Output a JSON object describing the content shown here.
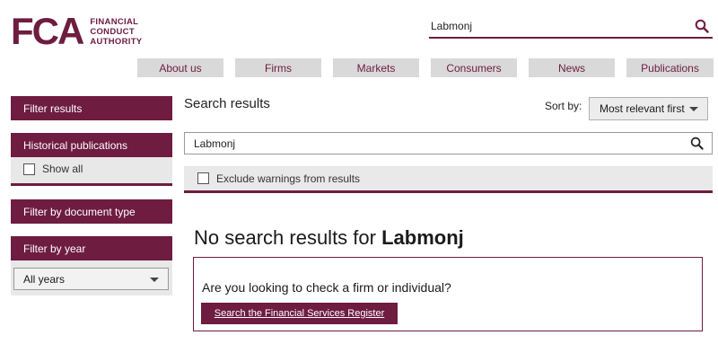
{
  "logo": {
    "mark": "FCA",
    "lines": [
      "FINANCIAL",
      "CONDUCT",
      "AUTHORITY"
    ]
  },
  "header_search": {
    "value": "Labmonj"
  },
  "nav": [
    "About us",
    "Firms",
    "Markets",
    "Consumers",
    "News",
    "Publications"
  ],
  "sidebar": {
    "filter_results": "Filter results",
    "historical_publications": "Historical publications",
    "show_all": "Show all",
    "filter_by_document_type": "Filter by document type",
    "filter_by_year": "Filter by year",
    "year_select": "All years"
  },
  "main": {
    "title": "Search results",
    "sort_label": "Sort by:",
    "sort_value": "Most relevant first",
    "search_value": "Labmonj",
    "exclude_label": "Exclude warnings from results",
    "no_results_prefix": "No search results for ",
    "no_results_term": "Labmonj",
    "check_question": "Are you looking to check a firm or individual?",
    "register_button": "Search the Financial Services Register"
  },
  "colors": {
    "brand": "#6e1c40",
    "nav_bg": "#d9d9d9",
    "panel_bg": "#e8e8e8"
  },
  "icons": {
    "search": "search-icon",
    "dropdown": "chevron-down-icon"
  }
}
